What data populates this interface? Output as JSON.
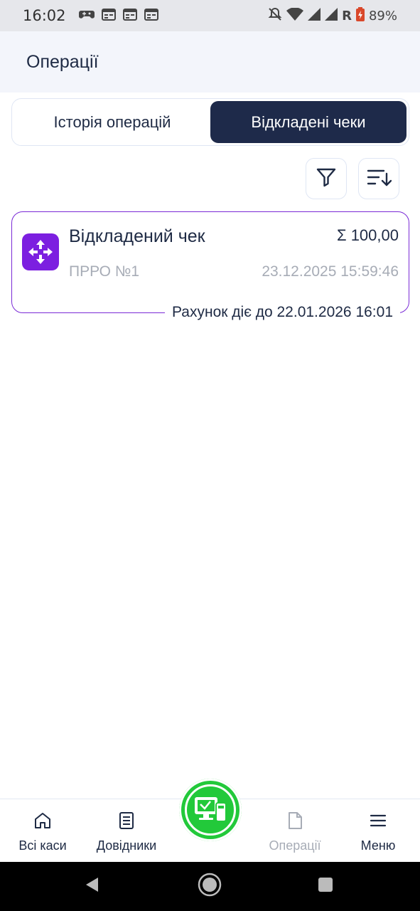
{
  "status_bar": {
    "time": "16:02",
    "network": "R",
    "battery": "89%"
  },
  "header": {
    "title": "Операції"
  },
  "tabs": [
    {
      "label": "Історія операцій",
      "active": false
    },
    {
      "label": "Відкладені чеки",
      "active": true
    }
  ],
  "toolbar": {
    "filter_icon": "filter-icon",
    "sort_icon": "sort-icon"
  },
  "deferred_checks": [
    {
      "title": "Відкладений чек",
      "sum": "Σ 100,00",
      "device": "ПРРО №1",
      "datetime": "23.12.2025 15:59:46",
      "valid_until": "Рахунок діє до 22.01.2026 16:01"
    }
  ],
  "bottom_nav": {
    "items": [
      {
        "label": "Всі каси",
        "icon": "home-icon",
        "active": true
      },
      {
        "label": "Довідники",
        "icon": "document-list-icon",
        "active": true
      },
      {
        "label": "Операції",
        "icon": "file-icon",
        "active": false
      },
      {
        "label": "Меню",
        "icon": "menu-icon",
        "active": true
      }
    ],
    "center_icon": "cash-register-icon"
  },
  "colors": {
    "primary_dark": "#1e2a4a",
    "accent_purple": "#7a2ad6",
    "fab_green": "#22c93a",
    "muted_text": "#a7acb6"
  }
}
